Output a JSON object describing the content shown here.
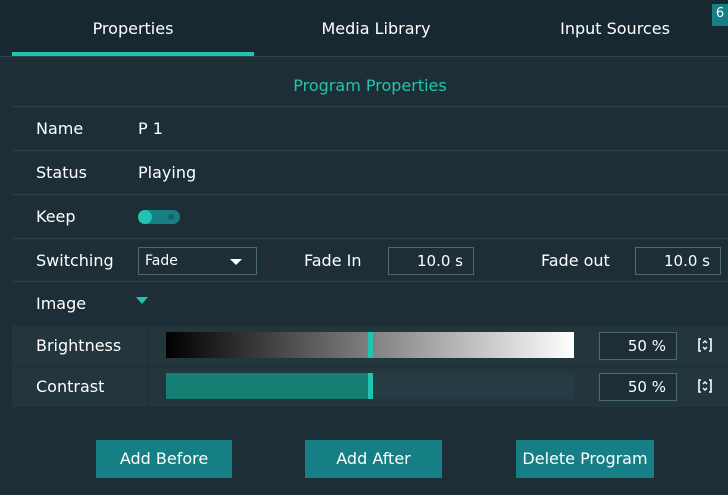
{
  "tabs": {
    "properties": "Properties",
    "media_library": "Media Library",
    "input_sources": "Input Sources",
    "corner_glyph": "6"
  },
  "section_title": "Program Properties",
  "name": {
    "label": "Name",
    "value": "P 1"
  },
  "status": {
    "label": "Status",
    "value": "Playing"
  },
  "keep": {
    "label": "Keep",
    "toggle_on": true
  },
  "switching": {
    "label": "Switching",
    "selected": "Fade",
    "fade_in_label": "Fade In",
    "fade_in_value": "10.0  s",
    "fade_out_label": "Fade out",
    "fade_out_value": "10.0  s"
  },
  "image": {
    "label": "Image"
  },
  "brightness": {
    "label": "Brightness",
    "value_text": "50  %",
    "level": 0.5
  },
  "contrast": {
    "label": "Contrast",
    "value_text": "50  %",
    "level": 0.5
  },
  "buttons": {
    "add_before": "Add Before",
    "add_after": "Add After",
    "delete_program": "Delete Program"
  },
  "colors": {
    "accent": "#21c4b0",
    "button": "#157f85",
    "background": "#1d2e36"
  },
  "icons": {
    "reset": "reset-icon",
    "dropdown": "chevron-down-icon"
  }
}
